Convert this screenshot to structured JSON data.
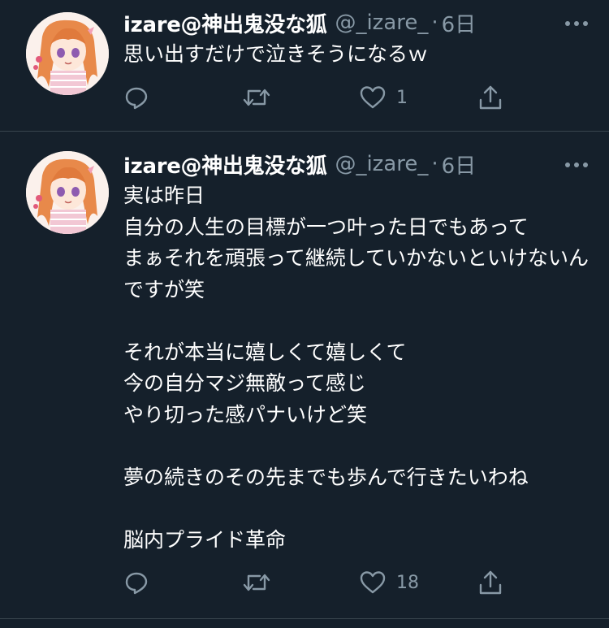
{
  "tweets": [
    {
      "display_name": "izare@神出鬼没な狐",
      "handle": "@_izare_",
      "separator": "·",
      "time": "6日",
      "text": "思い出すだけで泣きそうになるｗ",
      "reply_count": "",
      "retweet_count": "",
      "like_count": "1"
    },
    {
      "display_name": "izare@神出鬼没な狐",
      "handle": "@_izare_",
      "separator": "·",
      "time": "6日",
      "text": "実は昨日\n自分の人生の目標が一つ叶った日でもあって\nまぁそれを頑張って継続していかないといけないんですが笑\n\nそれが本当に嬉しくて嬉しくて\n今の自分マジ無敵って感じ\nやり切った感パナいけど笑\n\n夢の続きのその先までも歩んで行きたいわね\n\n脳内プライド革命",
      "reply_count": "",
      "retweet_count": "",
      "like_count": "18"
    }
  ],
  "colors": {
    "background": "#15202b",
    "secondary_text": "#8899a6",
    "divider": "#38444d"
  },
  "icons": [
    "reply-icon",
    "retweet-icon",
    "like-icon",
    "share-icon",
    "more-icon"
  ]
}
